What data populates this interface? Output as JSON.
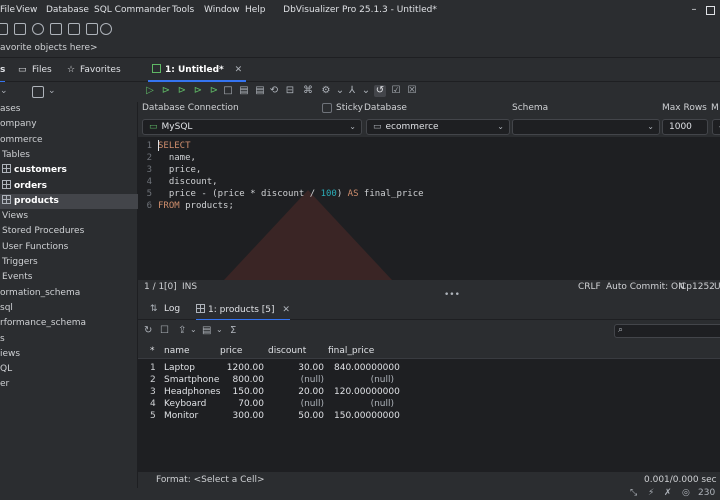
{
  "menu": [
    "File",
    "View",
    "Database",
    "SQL Commander",
    "Tools",
    "Window",
    "Help"
  ],
  "app_title": "DbVisualizer Pro 25.1.3 - Untitled*",
  "favorites_hint": "avorite objects here>",
  "left_tabs": {
    "objects": "s",
    "files": "Files",
    "favorites": "Favorites"
  },
  "tree": [
    {
      "label": "ases",
      "indent": 0,
      "kind": "text"
    },
    {
      "label": "ompany",
      "indent": 0,
      "kind": "text"
    },
    {
      "label": "ommerce",
      "indent": 0,
      "kind": "text"
    },
    {
      "label": "Tables",
      "indent": 1,
      "kind": "text"
    },
    {
      "label": "customers",
      "indent": 1,
      "kind": "table",
      "bold": true
    },
    {
      "label": "orders",
      "indent": 1,
      "kind": "table",
      "bold": true
    },
    {
      "label": "products",
      "indent": 1,
      "kind": "table",
      "bold": true,
      "selected": true
    },
    {
      "label": "Views",
      "indent": 1,
      "kind": "text"
    },
    {
      "label": "Stored Procedures",
      "indent": 1,
      "kind": "text"
    },
    {
      "label": "User Functions",
      "indent": 1,
      "kind": "text"
    },
    {
      "label": "Triggers",
      "indent": 1,
      "kind": "text"
    },
    {
      "label": "Events",
      "indent": 1,
      "kind": "text"
    },
    {
      "label": "ormation_schema",
      "indent": 0,
      "kind": "text"
    },
    {
      "label": "sql",
      "indent": 0,
      "kind": "text"
    },
    {
      "label": "rformance_schema",
      "indent": 0,
      "kind": "text"
    },
    {
      "label": "s",
      "indent": 0,
      "kind": "text"
    },
    {
      "label": "iews",
      "indent": 0,
      "kind": "text"
    },
    {
      "label": "QL",
      "indent": 0,
      "kind": "text"
    },
    {
      "label": "er",
      "indent": 0,
      "kind": "text"
    }
  ],
  "editor_tab": "1: Untitled*",
  "connection": {
    "db_conn_label": "Database Connection",
    "sticky_label": "Sticky",
    "database_label": "Database",
    "schema_label": "Schema",
    "max_rows_label": "Max Rows",
    "max_chars_label": "M",
    "conn_value": "MySQL",
    "database_value": "ecommerce",
    "schema_value": "",
    "max_rows_value": "1000",
    "max_chars_value": "-"
  },
  "code": [
    {
      "n": "1",
      "parts": [
        [
          "kw",
          "SELECT"
        ]
      ]
    },
    {
      "n": "2",
      "parts": [
        [
          "",
          "  name,"
        ]
      ]
    },
    {
      "n": "3",
      "parts": [
        [
          "",
          "  price,"
        ]
      ]
    },
    {
      "n": "4",
      "parts": [
        [
          "",
          "  discount,"
        ]
      ]
    },
    {
      "n": "5",
      "parts": [
        [
          "",
          "  price - (price * discount / "
        ],
        [
          "num",
          "100"
        ],
        [
          "",
          ") "
        ],
        [
          "kw",
          "AS"
        ],
        [
          "",
          " final_price"
        ]
      ]
    },
    {
      "n": "6",
      "parts": [
        [
          "kw",
          "FROM"
        ],
        [
          "",
          " products;"
        ]
      ]
    }
  ],
  "editor_status": {
    "pos": "1 / 1",
    "sel": "[0]",
    "mode": "INS",
    "eol": "CRLF",
    "autocommit": "Auto Commit: ON",
    "encoding": "Cp1252",
    "more": "U"
  },
  "result_tabs": {
    "log": "Log",
    "products": "1: products [5]"
  },
  "grid": {
    "headers": [
      "*",
      "name",
      "price",
      "discount",
      "final_price"
    ],
    "rows": [
      [
        "1",
        "Laptop",
        "1200.00",
        "30.00",
        "840.00000000"
      ],
      [
        "2",
        "Smartphone",
        "800.00",
        "(null)",
        "(null)"
      ],
      [
        "3",
        "Headphones",
        "150.00",
        "20.00",
        "120.00000000"
      ],
      [
        "4",
        "Keyboard",
        "70.00",
        "(null)",
        "(null)"
      ],
      [
        "5",
        "Monitor",
        "300.00",
        "50.00",
        "150.00000000"
      ]
    ]
  },
  "bottom": {
    "format": "Format: <Select a Cell>",
    "timing": "0.001/0.000 sec",
    "zoom": "230"
  },
  "colors": {
    "accent": "#3574f0",
    "keyword": "#cf8e6d",
    "number": "#2aacb8",
    "run": "#5fb865"
  }
}
